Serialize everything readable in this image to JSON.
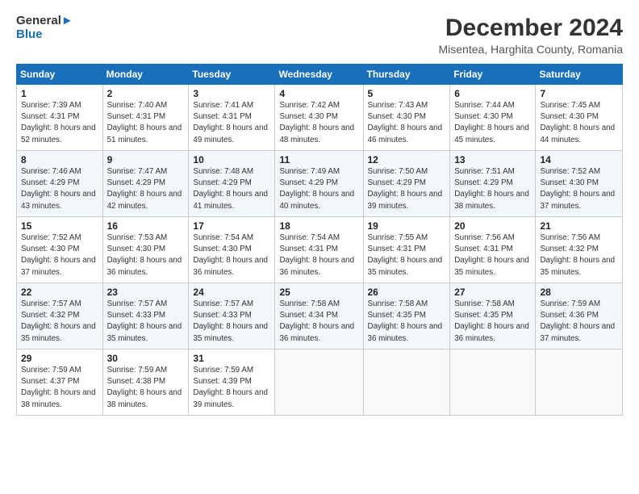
{
  "header": {
    "logo_line1": "General",
    "logo_line2": "Blue",
    "title": "December 2024",
    "subtitle": "Misentea, Harghita County, Romania"
  },
  "weekdays": [
    "Sunday",
    "Monday",
    "Tuesday",
    "Wednesday",
    "Thursday",
    "Friday",
    "Saturday"
  ],
  "weeks": [
    [
      {
        "day": "1",
        "sunrise": "Sunrise: 7:39 AM",
        "sunset": "Sunset: 4:31 PM",
        "daylight": "Daylight: 8 hours and 52 minutes."
      },
      {
        "day": "2",
        "sunrise": "Sunrise: 7:40 AM",
        "sunset": "Sunset: 4:31 PM",
        "daylight": "Daylight: 8 hours and 51 minutes."
      },
      {
        "day": "3",
        "sunrise": "Sunrise: 7:41 AM",
        "sunset": "Sunset: 4:31 PM",
        "daylight": "Daylight: 8 hours and 49 minutes."
      },
      {
        "day": "4",
        "sunrise": "Sunrise: 7:42 AM",
        "sunset": "Sunset: 4:30 PM",
        "daylight": "Daylight: 8 hours and 48 minutes."
      },
      {
        "day": "5",
        "sunrise": "Sunrise: 7:43 AM",
        "sunset": "Sunset: 4:30 PM",
        "daylight": "Daylight: 8 hours and 46 minutes."
      },
      {
        "day": "6",
        "sunrise": "Sunrise: 7:44 AM",
        "sunset": "Sunset: 4:30 PM",
        "daylight": "Daylight: 8 hours and 45 minutes."
      },
      {
        "day": "7",
        "sunrise": "Sunrise: 7:45 AM",
        "sunset": "Sunset: 4:30 PM",
        "daylight": "Daylight: 8 hours and 44 minutes."
      }
    ],
    [
      {
        "day": "8",
        "sunrise": "Sunrise: 7:46 AM",
        "sunset": "Sunset: 4:29 PM",
        "daylight": "Daylight: 8 hours and 43 minutes."
      },
      {
        "day": "9",
        "sunrise": "Sunrise: 7:47 AM",
        "sunset": "Sunset: 4:29 PM",
        "daylight": "Daylight: 8 hours and 42 minutes."
      },
      {
        "day": "10",
        "sunrise": "Sunrise: 7:48 AM",
        "sunset": "Sunset: 4:29 PM",
        "daylight": "Daylight: 8 hours and 41 minutes."
      },
      {
        "day": "11",
        "sunrise": "Sunrise: 7:49 AM",
        "sunset": "Sunset: 4:29 PM",
        "daylight": "Daylight: 8 hours and 40 minutes."
      },
      {
        "day": "12",
        "sunrise": "Sunrise: 7:50 AM",
        "sunset": "Sunset: 4:29 PM",
        "daylight": "Daylight: 8 hours and 39 minutes."
      },
      {
        "day": "13",
        "sunrise": "Sunrise: 7:51 AM",
        "sunset": "Sunset: 4:29 PM",
        "daylight": "Daylight: 8 hours and 38 minutes."
      },
      {
        "day": "14",
        "sunrise": "Sunrise: 7:52 AM",
        "sunset": "Sunset: 4:30 PM",
        "daylight": "Daylight: 8 hours and 37 minutes."
      }
    ],
    [
      {
        "day": "15",
        "sunrise": "Sunrise: 7:52 AM",
        "sunset": "Sunset: 4:30 PM",
        "daylight": "Daylight: 8 hours and 37 minutes."
      },
      {
        "day": "16",
        "sunrise": "Sunrise: 7:53 AM",
        "sunset": "Sunset: 4:30 PM",
        "daylight": "Daylight: 8 hours and 36 minutes."
      },
      {
        "day": "17",
        "sunrise": "Sunrise: 7:54 AM",
        "sunset": "Sunset: 4:30 PM",
        "daylight": "Daylight: 8 hours and 36 minutes."
      },
      {
        "day": "18",
        "sunrise": "Sunrise: 7:54 AM",
        "sunset": "Sunset: 4:31 PM",
        "daylight": "Daylight: 8 hours and 36 minutes."
      },
      {
        "day": "19",
        "sunrise": "Sunrise: 7:55 AM",
        "sunset": "Sunset: 4:31 PM",
        "daylight": "Daylight: 8 hours and 35 minutes."
      },
      {
        "day": "20",
        "sunrise": "Sunrise: 7:56 AM",
        "sunset": "Sunset: 4:31 PM",
        "daylight": "Daylight: 8 hours and 35 minutes."
      },
      {
        "day": "21",
        "sunrise": "Sunrise: 7:56 AM",
        "sunset": "Sunset: 4:32 PM",
        "daylight": "Daylight: 8 hours and 35 minutes."
      }
    ],
    [
      {
        "day": "22",
        "sunrise": "Sunrise: 7:57 AM",
        "sunset": "Sunset: 4:32 PM",
        "daylight": "Daylight: 8 hours and 35 minutes."
      },
      {
        "day": "23",
        "sunrise": "Sunrise: 7:57 AM",
        "sunset": "Sunset: 4:33 PM",
        "daylight": "Daylight: 8 hours and 35 minutes."
      },
      {
        "day": "24",
        "sunrise": "Sunrise: 7:57 AM",
        "sunset": "Sunset: 4:33 PM",
        "daylight": "Daylight: 8 hours and 35 minutes."
      },
      {
        "day": "25",
        "sunrise": "Sunrise: 7:58 AM",
        "sunset": "Sunset: 4:34 PM",
        "daylight": "Daylight: 8 hours and 36 minutes."
      },
      {
        "day": "26",
        "sunrise": "Sunrise: 7:58 AM",
        "sunset": "Sunset: 4:35 PM",
        "daylight": "Daylight: 8 hours and 36 minutes."
      },
      {
        "day": "27",
        "sunrise": "Sunrise: 7:58 AM",
        "sunset": "Sunset: 4:35 PM",
        "daylight": "Daylight: 8 hours and 36 minutes."
      },
      {
        "day": "28",
        "sunrise": "Sunrise: 7:59 AM",
        "sunset": "Sunset: 4:36 PM",
        "daylight": "Daylight: 8 hours and 37 minutes."
      }
    ],
    [
      {
        "day": "29",
        "sunrise": "Sunrise: 7:59 AM",
        "sunset": "Sunset: 4:37 PM",
        "daylight": "Daylight: 8 hours and 38 minutes."
      },
      {
        "day": "30",
        "sunrise": "Sunrise: 7:59 AM",
        "sunset": "Sunset: 4:38 PM",
        "daylight": "Daylight: 8 hours and 38 minutes."
      },
      {
        "day": "31",
        "sunrise": "Sunrise: 7:59 AM",
        "sunset": "Sunset: 4:39 PM",
        "daylight": "Daylight: 8 hours and 39 minutes."
      },
      null,
      null,
      null,
      null
    ]
  ]
}
